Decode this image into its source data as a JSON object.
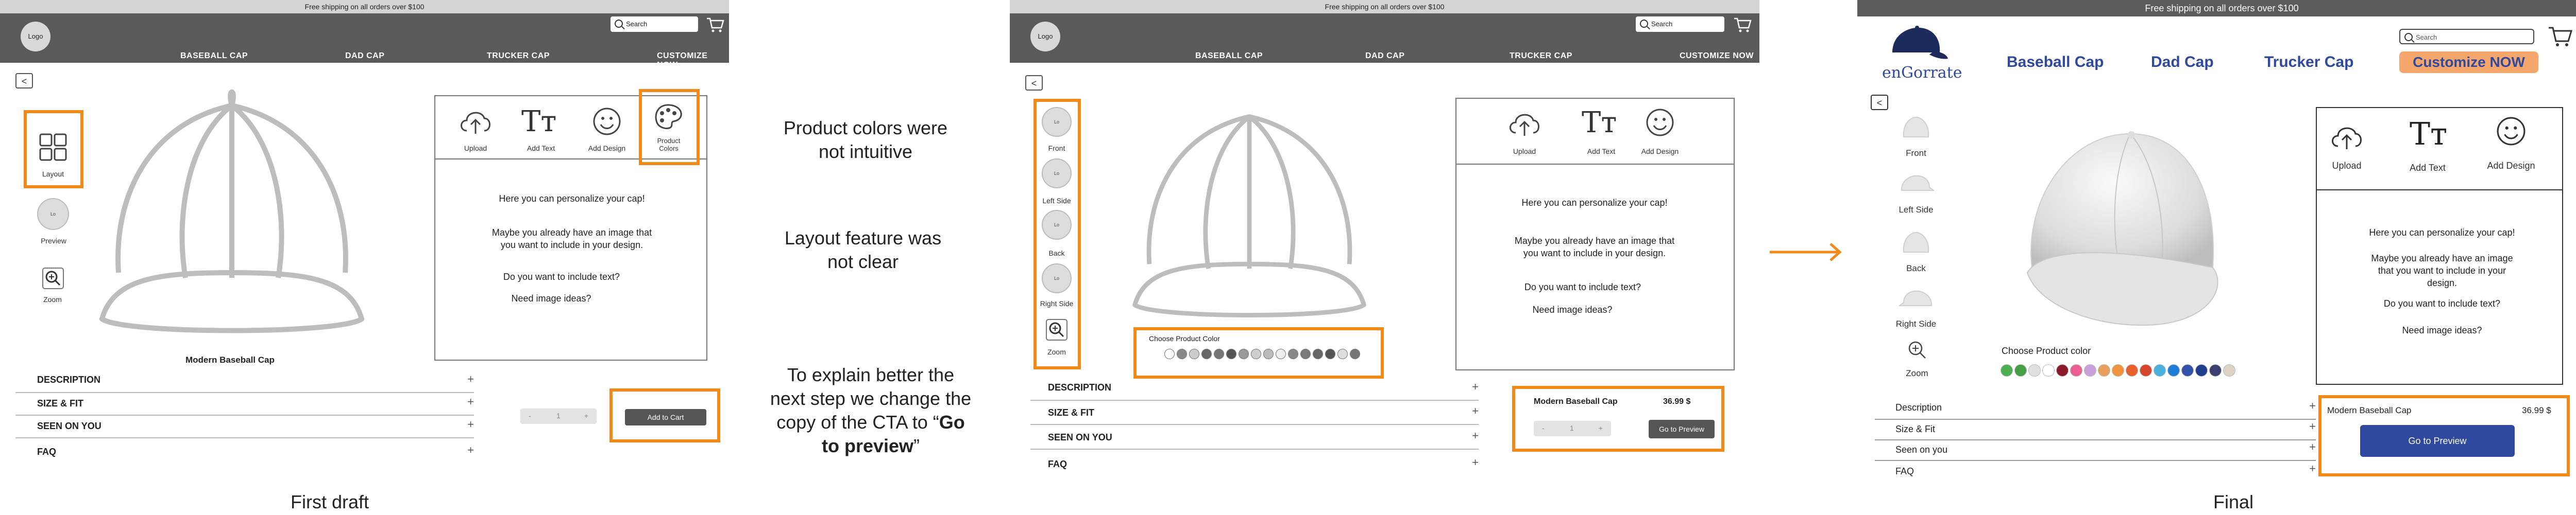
{
  "shipping": "Free shipping on all orders over $100",
  "logo": "Logo",
  "search": {
    "placeholder": "Search"
  },
  "nav": [
    "BASEBALL CAP",
    "DAD CAP",
    "TRUCKER CAP",
    "CUSTOMIZE NOW"
  ],
  "tools": {
    "upload": "Upload",
    "text": "Add Text",
    "design": "Add Design",
    "colors": "Product Colors"
  },
  "panel": {
    "p1": "Here you can personalize your cap!",
    "p2": "Maybe you already have an image that you want to include in your design.",
    "p3": "Do you want to include text?",
    "p4": "Need image ideas?"
  },
  "accordion": [
    "DESCRIPTION",
    "SIZE & FIT",
    "SEEN ON YOU",
    "FAQ"
  ],
  "draft": {
    "side_layout": "Layout",
    "side_preview": "Preview",
    "side_zoom": "Zoom",
    "thumb": "Lo",
    "product_title": "Modern Baseball Cap",
    "cta": "Add to Cart",
    "caption": "First draft"
  },
  "annotations": {
    "a1": "Product colors were not intuitive",
    "a2": "Layout feature was not clear",
    "a3_prefix": "To explain better the next step we change the copy of the CTA to “",
    "a3_bold": "Go to preview",
    "a3_suffix": "”"
  },
  "mid": {
    "views": [
      "Front",
      "Left Side",
      "Back",
      "Right Side",
      "Zoom"
    ],
    "choose_color": "Choose Product Color",
    "product_title": "Modern Baseball Cap",
    "price": "36.99 $",
    "cta": "Go to Preview"
  },
  "final": {
    "brand": "enGorrate",
    "nav": [
      "Baseball Cap",
      "Dad Cap",
      "Trucker Cap",
      "Customize NOW"
    ],
    "views": [
      "Front",
      "Left Side",
      "Back",
      "Right Side",
      "Zoom"
    ],
    "choose_color": "Choose Product color",
    "accordion": [
      "Description",
      "Size & Fit",
      "Seen on you",
      "FAQ"
    ],
    "product_title": "Modern Baseball Cap",
    "price": "36.99 $",
    "cta": "Go to Preview",
    "caption": "Final",
    "accent": "#2f49a0",
    "customize_bg": "#f5a66b"
  },
  "colors": {
    "highlight": "#f28a1a",
    "swatches_mid": [
      "#ffffff",
      "#888888",
      "#cccccc",
      "#666666",
      "#777777",
      "#555555",
      "#999999",
      "#cfcfcf",
      "#bbbbbb",
      "#eeeeee",
      "#888888",
      "#7a7a7a",
      "#666666",
      "#555555",
      "#dddddd",
      "#777777"
    ],
    "swatches_final": [
      "#4caf50",
      "#43a047",
      "#e0e0e0",
      "#ffffff",
      "#8b1a2b",
      "#ec5d94",
      "#c9a0dc",
      "#e8a15c",
      "#f1943c",
      "#e8602c",
      "#d4472e",
      "#47b2e0",
      "#1c7ed6",
      "#3251a8",
      "#213e8e",
      "#3a3f6e",
      "#dcd3c3"
    ]
  }
}
